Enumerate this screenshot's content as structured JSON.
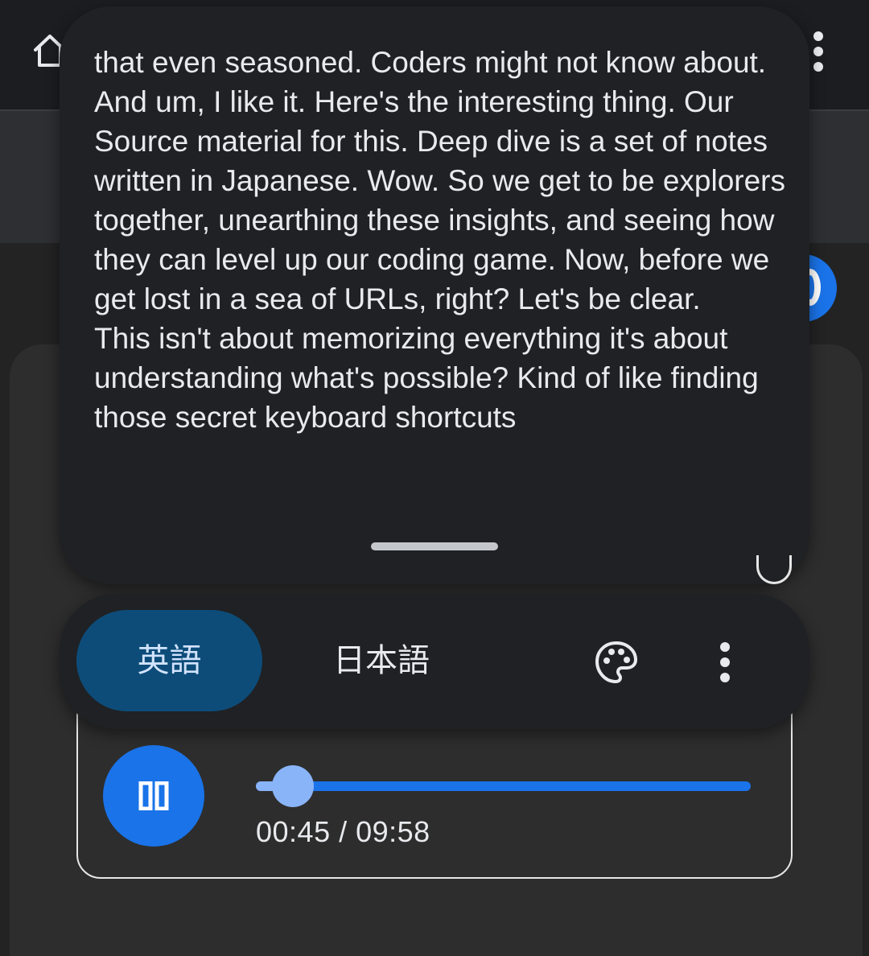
{
  "transcript": {
    "text": "that even seasoned. Coders might not know about.\nAnd um, I like it. Here's the interesting thing. Our Source material for this. Deep dive is a set of notes written in Japanese. Wow. So we get to be explorers together, unearthing these insights, and seeing how they can level up our coding game. Now, before we get lost in a sea of URLs, right? Let's be clear.\nThis isn't about memorizing everything it's about understanding what's possible? Kind of like finding those secret keyboard shortcuts"
  },
  "toolbar": {
    "languages": [
      "英語",
      "日本語"
    ],
    "selected_language": "英語",
    "palette_icon": "palette-icon",
    "more_icon": "more-vert-icon"
  },
  "header": {
    "home_icon": "home-icon",
    "more_icon": "more-vert-icon"
  },
  "player": {
    "state": "playing",
    "button_icon": "pause-icon",
    "time": "00:45 / 09:58",
    "elapsed_seconds": 45,
    "duration_seconds": 598,
    "colors": {
      "accent": "#1a73e8",
      "progress_played": "#8ab4f8",
      "selected_tab": "#0d4c79"
    }
  }
}
